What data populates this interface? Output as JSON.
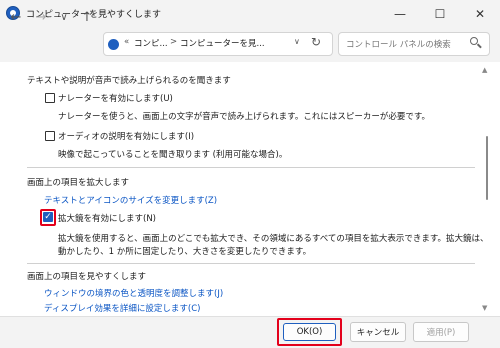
{
  "window": {
    "title": "コンピューターを見やすくします",
    "minimize": "—",
    "maximize": "☐",
    "close": "✕"
  },
  "nav": {
    "back": "←",
    "forward": "→",
    "recent": "∨",
    "up": "↑",
    "address_prefix": "«",
    "address_part1": "コンピ...",
    "address_sep": ">",
    "address_part2": "コンピューターを見...",
    "address_dropdown": "∨",
    "refresh": "↻",
    "search_placeholder": "コントロール パネルの検索"
  },
  "section_hear": {
    "heading": "テキストや説明が音声で読み上げられるのを聞きます",
    "narrator_label": "ナレーターを有効にします(U)",
    "narrator_checked": false,
    "narrator_desc": "ナレーターを使うと、画面上の文字が音声で読み上げられます。これにはスピーカーが必要です。",
    "audio_label": "オーディオの説明を有効にします(I)",
    "audio_checked": false,
    "audio_desc": "映像で起こっていることを聞き取ります (利用可能な場合)。"
  },
  "section_enlarge": {
    "heading": "画面上の項目を拡大します",
    "link": "テキストとアイコンのサイズを変更します(Z)",
    "magnifier_label": "拡大鏡を有効にします(N)",
    "magnifier_checked": true,
    "magnifier_desc_line1": "拡大鏡を使用すると、画面上のどこでも拡大でき、その領域にあるすべての項目を拡大表示できます。拡大鏡は、",
    "magnifier_desc_line2": "動かしたり、1 か所に固定したり、大きさを変更したりできます。"
  },
  "section_visible": {
    "heading": "画面上の項目を見やすくします",
    "link1": "ウィンドウの境界の色と透明度を調整します(J)",
    "link2": "ディスプレイ効果を詳細に設定します(C)"
  },
  "footer": {
    "ok": "OK(O)",
    "cancel": "キャンセル",
    "apply": "適用(P)"
  },
  "colors": {
    "accent": "#1f5fbf",
    "highlight": "#e3001b",
    "link": "#0a55c4"
  }
}
